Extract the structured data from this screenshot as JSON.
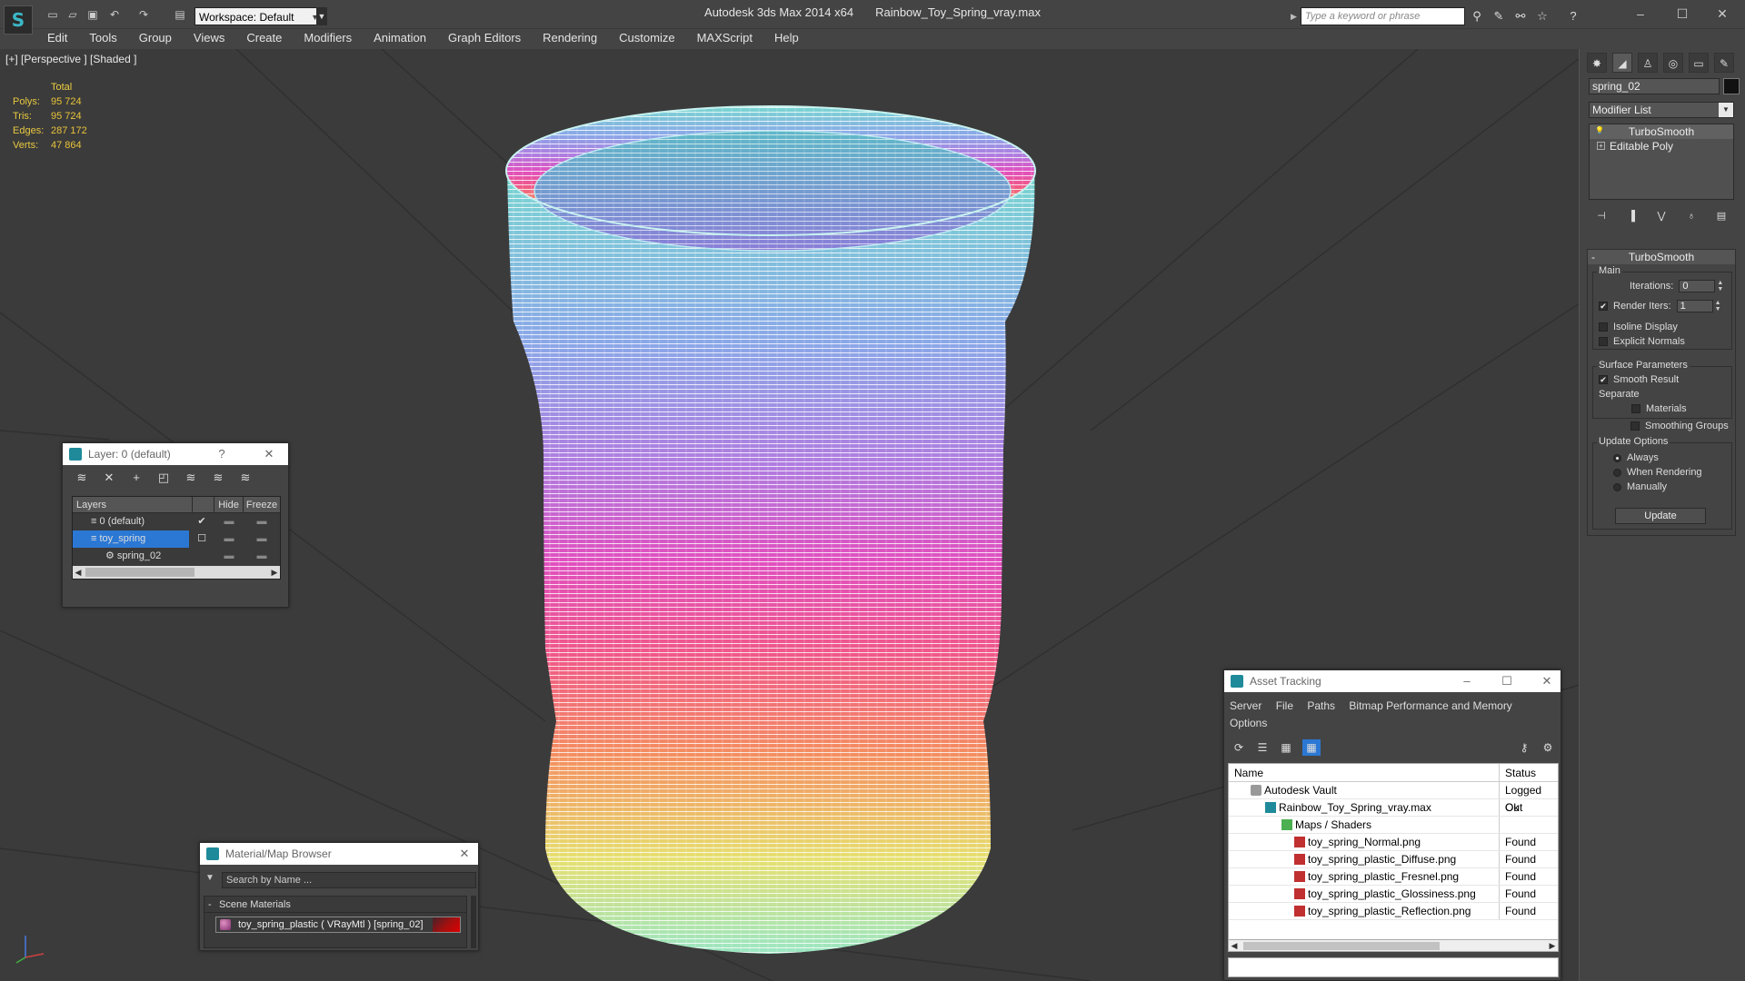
{
  "titlebar": {
    "workspace": "Workspace: Default",
    "app_title": "Autodesk 3ds Max  2014 x64",
    "file_name": "Rainbow_Toy_Spring_vray.max",
    "search_placeholder": "Type a keyword or phrase"
  },
  "menu": [
    "Edit",
    "Tools",
    "Group",
    "Views",
    "Create",
    "Modifiers",
    "Animation",
    "Graph Editors",
    "Rendering",
    "Customize",
    "MAXScript",
    "Help"
  ],
  "viewport": {
    "label": "[+] [Perspective ] [Shaded ]",
    "stats_header": "Total",
    "stats": [
      {
        "label": "Polys:",
        "value": "95 724"
      },
      {
        "label": "Tris:",
        "value": "95 724"
      },
      {
        "label": "Edges:",
        "value": "287 172"
      },
      {
        "label": "Verts:",
        "value": "47 864"
      }
    ]
  },
  "command_panel": {
    "object_name": "spring_02",
    "modifier_list": "Modifier List",
    "stack": [
      "TurboSmooth",
      "Editable Poly"
    ],
    "rollout_title": "TurboSmooth",
    "main_label": "Main",
    "iterations_label": "Iterations:",
    "iterations_value": "0",
    "render_iters_label": "Render Iters:",
    "render_iters_value": "1",
    "isoline_label": "Isoline Display",
    "explicit_normals_label": "Explicit Normals",
    "surface_params_label": "Surface Parameters",
    "smooth_result_label": "Smooth Result",
    "separate_label": "Separate",
    "materials_label": "Materials",
    "smoothing_groups_label": "Smoothing Groups",
    "update_options_label": "Update Options",
    "always_label": "Always",
    "when_rendering_label": "When Rendering",
    "manually_label": "Manually",
    "update_button": "Update"
  },
  "layer_window": {
    "title": "Layer: 0 (default)",
    "help": "?",
    "col_layers": "Layers",
    "col_hide": "Hide",
    "col_freeze": "Freeze",
    "rows": [
      {
        "name": "0 (default)"
      },
      {
        "name": "toy_spring"
      },
      {
        "name": "spring_02"
      }
    ]
  },
  "material_browser": {
    "title": "Material/Map Browser",
    "search_placeholder": "Search by Name ...",
    "group": "Scene Materials",
    "item": "toy_spring_plastic ( VRayMtl ) [spring_02]"
  },
  "asset_tracking": {
    "title": "Asset Tracking",
    "menu": [
      "Server",
      "File",
      "Paths",
      "Bitmap Performance and Memory",
      "Options"
    ],
    "col_name": "Name",
    "col_status": "Status",
    "rows": [
      {
        "name": "Autodesk Vault",
        "status": "Logged Out"
      },
      {
        "name": "Rainbow_Toy_Spring_vray.max",
        "status": "Ok"
      },
      {
        "name": "Maps / Shaders",
        "status": ""
      },
      {
        "name": "toy_spring_Normal.png",
        "status": "Found"
      },
      {
        "name": "toy_spring_plastic_Diffuse.png",
        "status": "Found"
      },
      {
        "name": "toy_spring_plastic_Fresnel.png",
        "status": "Found"
      },
      {
        "name": "toy_spring_plastic_Glossiness.png",
        "status": "Found"
      },
      {
        "name": "toy_spring_plastic_Reflection.png",
        "status": "Found"
      }
    ]
  },
  "colors": {
    "selection": "#2b78d4",
    "stats_text": "#e8c33a",
    "accent": "#3bb7c7"
  }
}
